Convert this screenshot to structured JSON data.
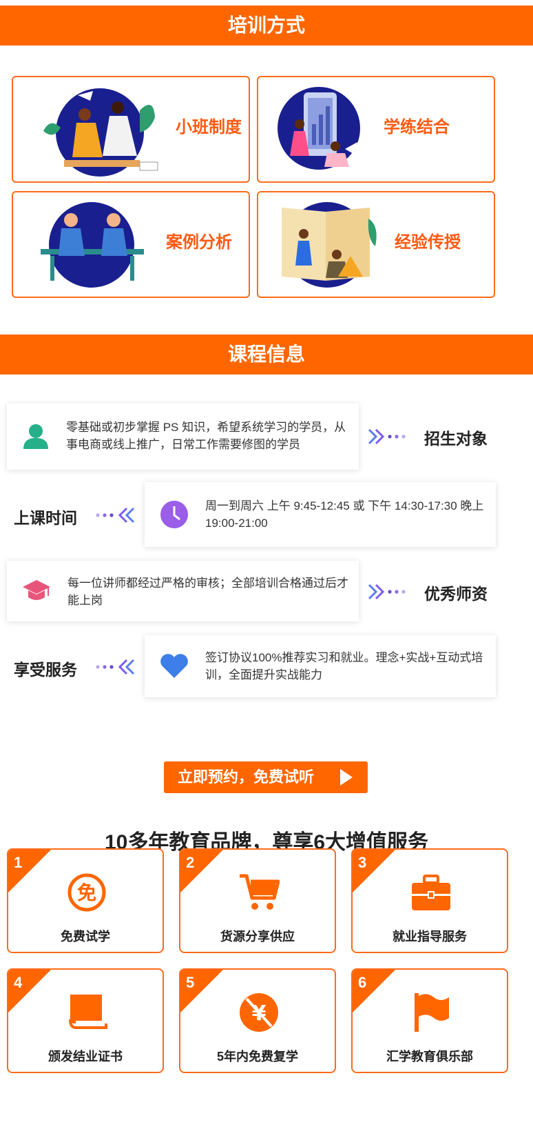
{
  "sections": {
    "training_title": "培训方式",
    "course_title": "课程信息"
  },
  "training_methods": [
    {
      "label": "小班制度"
    },
    {
      "label": "学练结合"
    },
    {
      "label": "案例分析"
    },
    {
      "label": "经验传授"
    }
  ],
  "course_info": [
    {
      "label": "招生对象",
      "text": "零基础或初步掌握 PS 知识，希望系统学习的学员，从事电商或线上推广，日常工作需要修图的学员",
      "icon": "person-icon"
    },
    {
      "label": "上课时间",
      "text": "周一到周六 上午 9:45-12:45 或 下午 14:30-17:30 晚上 19:00-21:00",
      "icon": "clock-icon"
    },
    {
      "label": "优秀师资",
      "text": "每一位讲师都经过严格的审核；全部培训合格通过后才能上岗",
      "icon": "graduation-cap-icon"
    },
    {
      "label": "享受服务",
      "text": "签订协议100%推荐实习和就业。理念+实战+互动式培训，全面提升实战能力",
      "icon": "heart-icon"
    }
  ],
  "cta": {
    "label": "立即预约，免费试听"
  },
  "services": {
    "title": "10多年教育品牌，尊享6大增值服务",
    "items": [
      {
        "num": "1",
        "label": "免费试学",
        "icon": "free-badge-icon"
      },
      {
        "num": "2",
        "label": "货源分享供应",
        "icon": "shopping-cart-icon"
      },
      {
        "num": "3",
        "label": "就业指导服务",
        "icon": "briefcase-icon"
      },
      {
        "num": "4",
        "label": "颁发结业证书",
        "icon": "certificate-book-icon"
      },
      {
        "num": "5",
        "label": "5年内免费复学",
        "icon": "yen-free-icon"
      },
      {
        "num": "6",
        "label": "汇学教育俱乐部",
        "icon": "flag-icon"
      }
    ]
  },
  "colors": {
    "accent": "#ff6600",
    "card_title": "#ff5a12",
    "text": "#333333"
  }
}
